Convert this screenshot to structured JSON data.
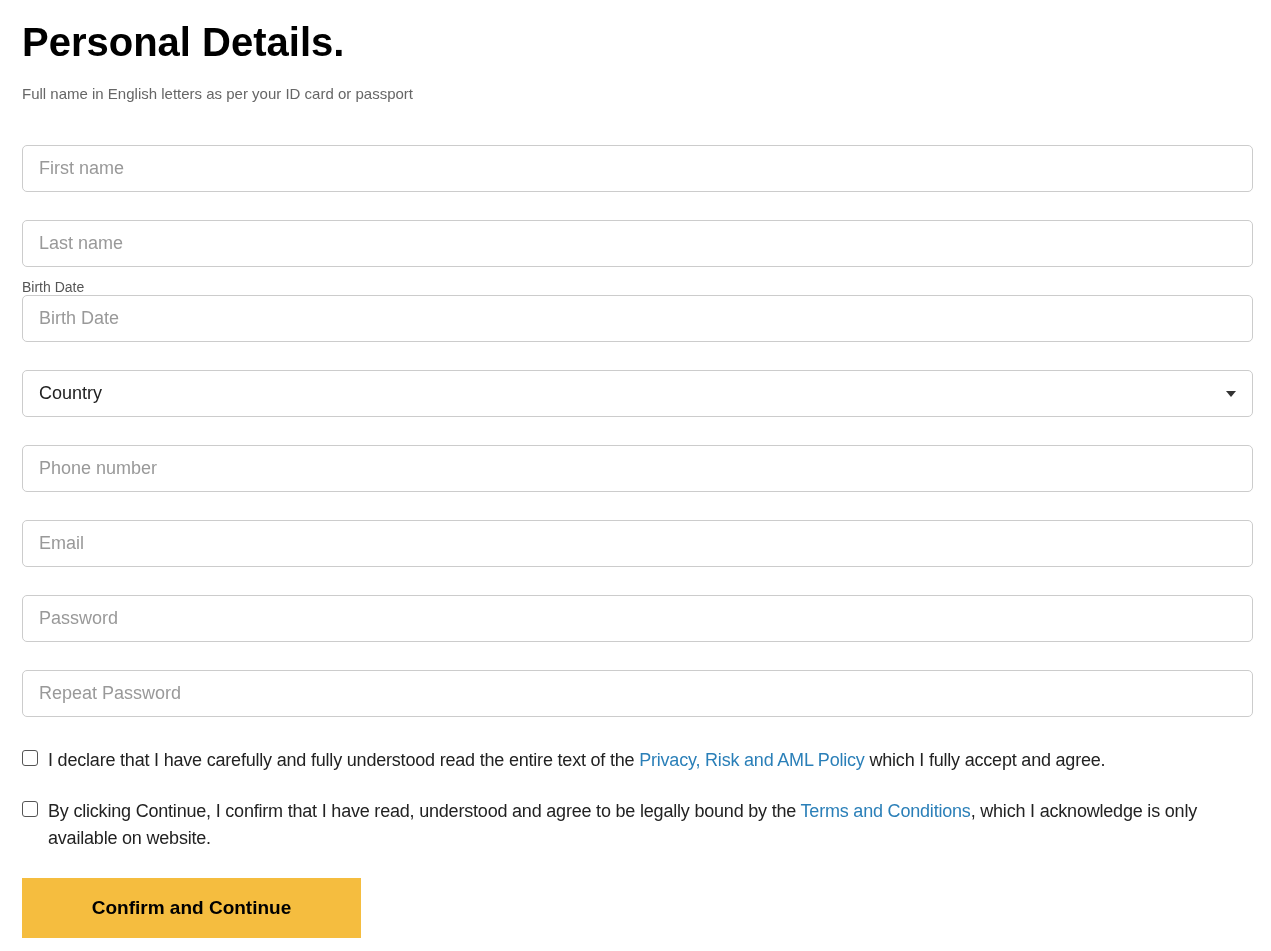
{
  "title": "Personal Details.",
  "subtitle": "Full name in English letters as per your ID card or passport",
  "fields": [
    {
      "kind": "input",
      "placeholder": "First name"
    },
    {
      "kind": "input",
      "placeholder": "Last name"
    },
    {
      "kind": "input",
      "label": "Birth Date",
      "placeholder": "Birth Date"
    },
    {
      "kind": "select",
      "value": "Country"
    },
    {
      "kind": "input",
      "placeholder": "Phone number"
    },
    {
      "kind": "input",
      "placeholder": "Email"
    },
    {
      "kind": "input",
      "placeholder": "Password"
    },
    {
      "kind": "input",
      "placeholder": "Repeat Password"
    }
  ],
  "agreements": [
    {
      "checked": false,
      "text_before": "I declare that I have carefully and fully understood read the entire text of the ",
      "link": "Privacy, Risk and AML Policy",
      "text_after": " which I fully accept and agree."
    },
    {
      "checked": false,
      "text_before": "By clicking Continue, I confirm that I have read, understood and agree to be legally bound by the ",
      "link": "Terms and Conditions",
      "text_after": ", which I acknowledge is only available on website."
    }
  ],
  "submit": "Confirm and Continue"
}
